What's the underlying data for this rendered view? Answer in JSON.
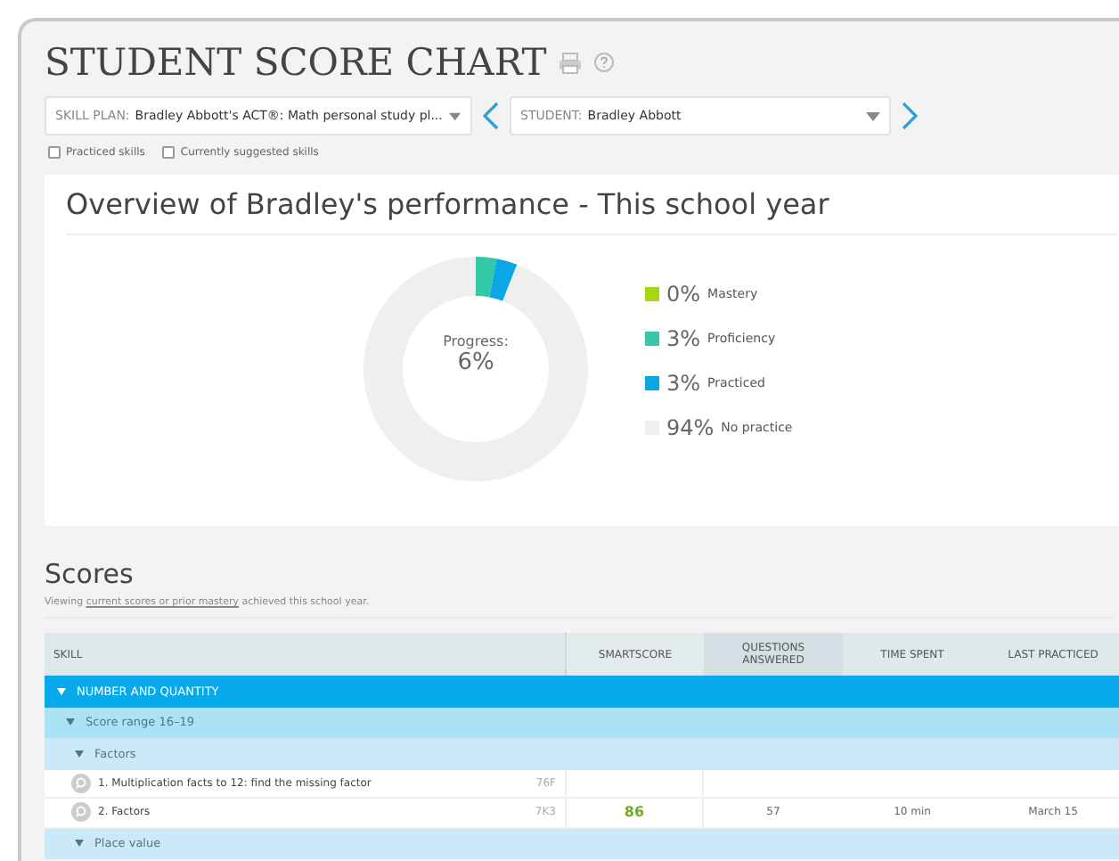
{
  "title": "STUDENT SCORE CHART",
  "skill_plan": {
    "label": "SKILL PLAN:",
    "value": "Bradley Abbott's ACT®: Math personal study pl..."
  },
  "student": {
    "label": "STUDENT:",
    "value": "Bradley Abbott"
  },
  "filters": [
    {
      "label": "Practiced skills",
      "checked": false
    },
    {
      "label": "Currently suggested skills",
      "checked": false
    }
  ],
  "overview": {
    "title": "Overview of Bradley's performance - This school year",
    "center_label": "Progress:",
    "center_value": "6%",
    "chart_data": {
      "type": "donut",
      "categories": [
        "Mastery",
        "Proficiency",
        "Practiced",
        "No practice"
      ],
      "values": [
        0,
        3,
        3,
        94
      ]
    },
    "legend": [
      {
        "percent": "0%",
        "color": "#a6d810"
      },
      {
        "percent": "3%",
        "color": "#33c9a6"
      },
      {
        "percent": "3%",
        "color": "#0aa6e6"
      },
      {
        "percent": "94%",
        "color": "#efefef"
      }
    ]
  },
  "scores": {
    "title": "Scores",
    "note_before": "Viewing",
    "note_link": "current scores or prior mastery",
    "note_after": "achieved this school year.",
    "columns": [
      "SKILL",
      "SMARTSCORE",
      "QUESTIONS ANSWERED",
      "TIME SPENT",
      "LAST PRACTICED"
    ],
    "groups": [
      {
        "label": "NUMBER AND QUANTITY",
        "expanded": true,
        "children": [
          {
            "label": "Score range 16–19",
            "expanded": true,
            "children": [
              {
                "label": "Factors",
                "expanded": true,
                "skills": [
                  {
                    "name": "1. Multiplication facts to 12: find the missing factor",
                    "code": "76F"
                  },
                  {
                    "name": "2. Factors",
                    "code": "7K3",
                    "smartscore": "86",
                    "questions": "57",
                    "time": "10 min",
                    "last": "March 15"
                  }
                ]
              },
              {
                "label": "Place value",
                "expanded": true
              }
            ]
          }
        ]
      }
    ]
  }
}
